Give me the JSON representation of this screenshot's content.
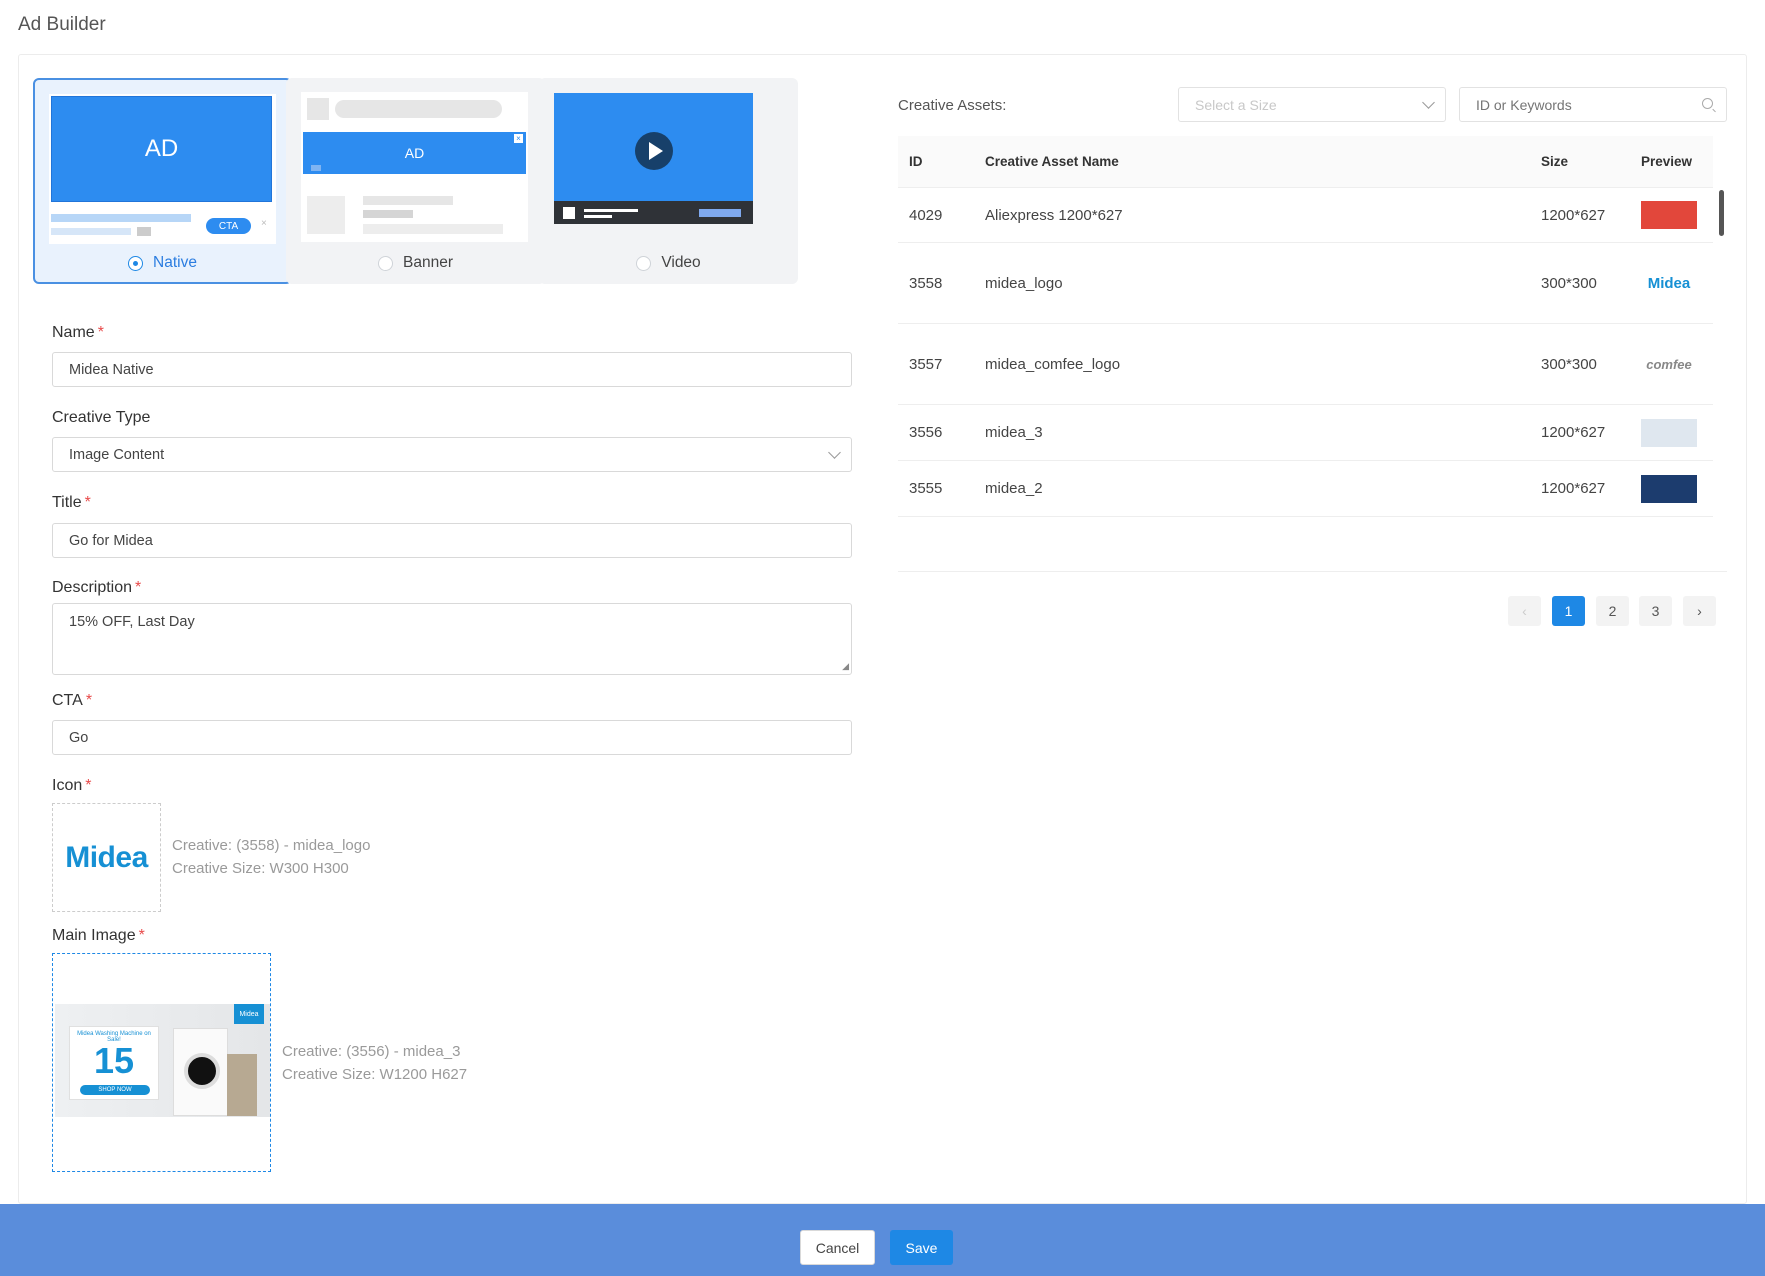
{
  "page": {
    "title": "Ad Builder"
  },
  "types": [
    {
      "key": "native",
      "label": "Native",
      "selected": true,
      "preview_text": "AD",
      "cta": "CTA"
    },
    {
      "key": "banner",
      "label": "Banner",
      "selected": false,
      "preview_text": "AD"
    },
    {
      "key": "video",
      "label": "Video",
      "selected": false
    }
  ],
  "form": {
    "name": {
      "label": "Name",
      "value": "Midea Native"
    },
    "creative_type": {
      "label": "Creative Type",
      "value": "Image Content"
    },
    "title": {
      "label": "Title",
      "value": "Go for Midea"
    },
    "description": {
      "label": "Description",
      "value": "15% OFF, Last Day"
    },
    "cta": {
      "label": "CTA",
      "value": "Go"
    },
    "icon": {
      "label": "Icon",
      "creative": "Creative: (3558) - midea_logo",
      "size": "Creative Size: W300 H300",
      "logo_text": "Midea"
    },
    "main_image": {
      "label": "Main Image",
      "creative": "Creative: (3556) - midea_3",
      "size": "Creative Size: W1200 H627",
      "promo_heading": "Midea Washing Machine on Sale!",
      "promo_big": "15",
      "promo_button": "SHOP NOW",
      "promo_logo": "Midea"
    }
  },
  "assets": {
    "label": "Creative Assets:",
    "size_placeholder": "Select a Size",
    "search_placeholder": "ID or Keywords",
    "columns": {
      "id": "ID",
      "name": "Creative Asset Name",
      "size": "Size",
      "preview": "Preview"
    },
    "rows": [
      {
        "id": "4029",
        "name": "Aliexpress 1200*627",
        "size": "1200*627",
        "preview_color": "#e2473b"
      },
      {
        "id": "3558",
        "name": "midea_logo",
        "size": "300*300",
        "preview_text": "Midea"
      },
      {
        "id": "3557",
        "name": "midea_comfee_logo",
        "size": "300*300",
        "preview_text": "comfee"
      },
      {
        "id": "3556",
        "name": "midea_3",
        "size": "1200*627",
        "preview_color": "#dfe7ef"
      },
      {
        "id": "3555",
        "name": "midea_2",
        "size": "1200*627",
        "preview_color": "#1c3c6e"
      }
    ],
    "pages": [
      "1",
      "2",
      "3"
    ],
    "current_page": "1"
  },
  "footer": {
    "cancel_label": "Cancel",
    "save_label": "Save"
  },
  "colors": {
    "accent": "#1e88e5",
    "footer": "#5a8ddb",
    "required": "#e84a4a"
  }
}
